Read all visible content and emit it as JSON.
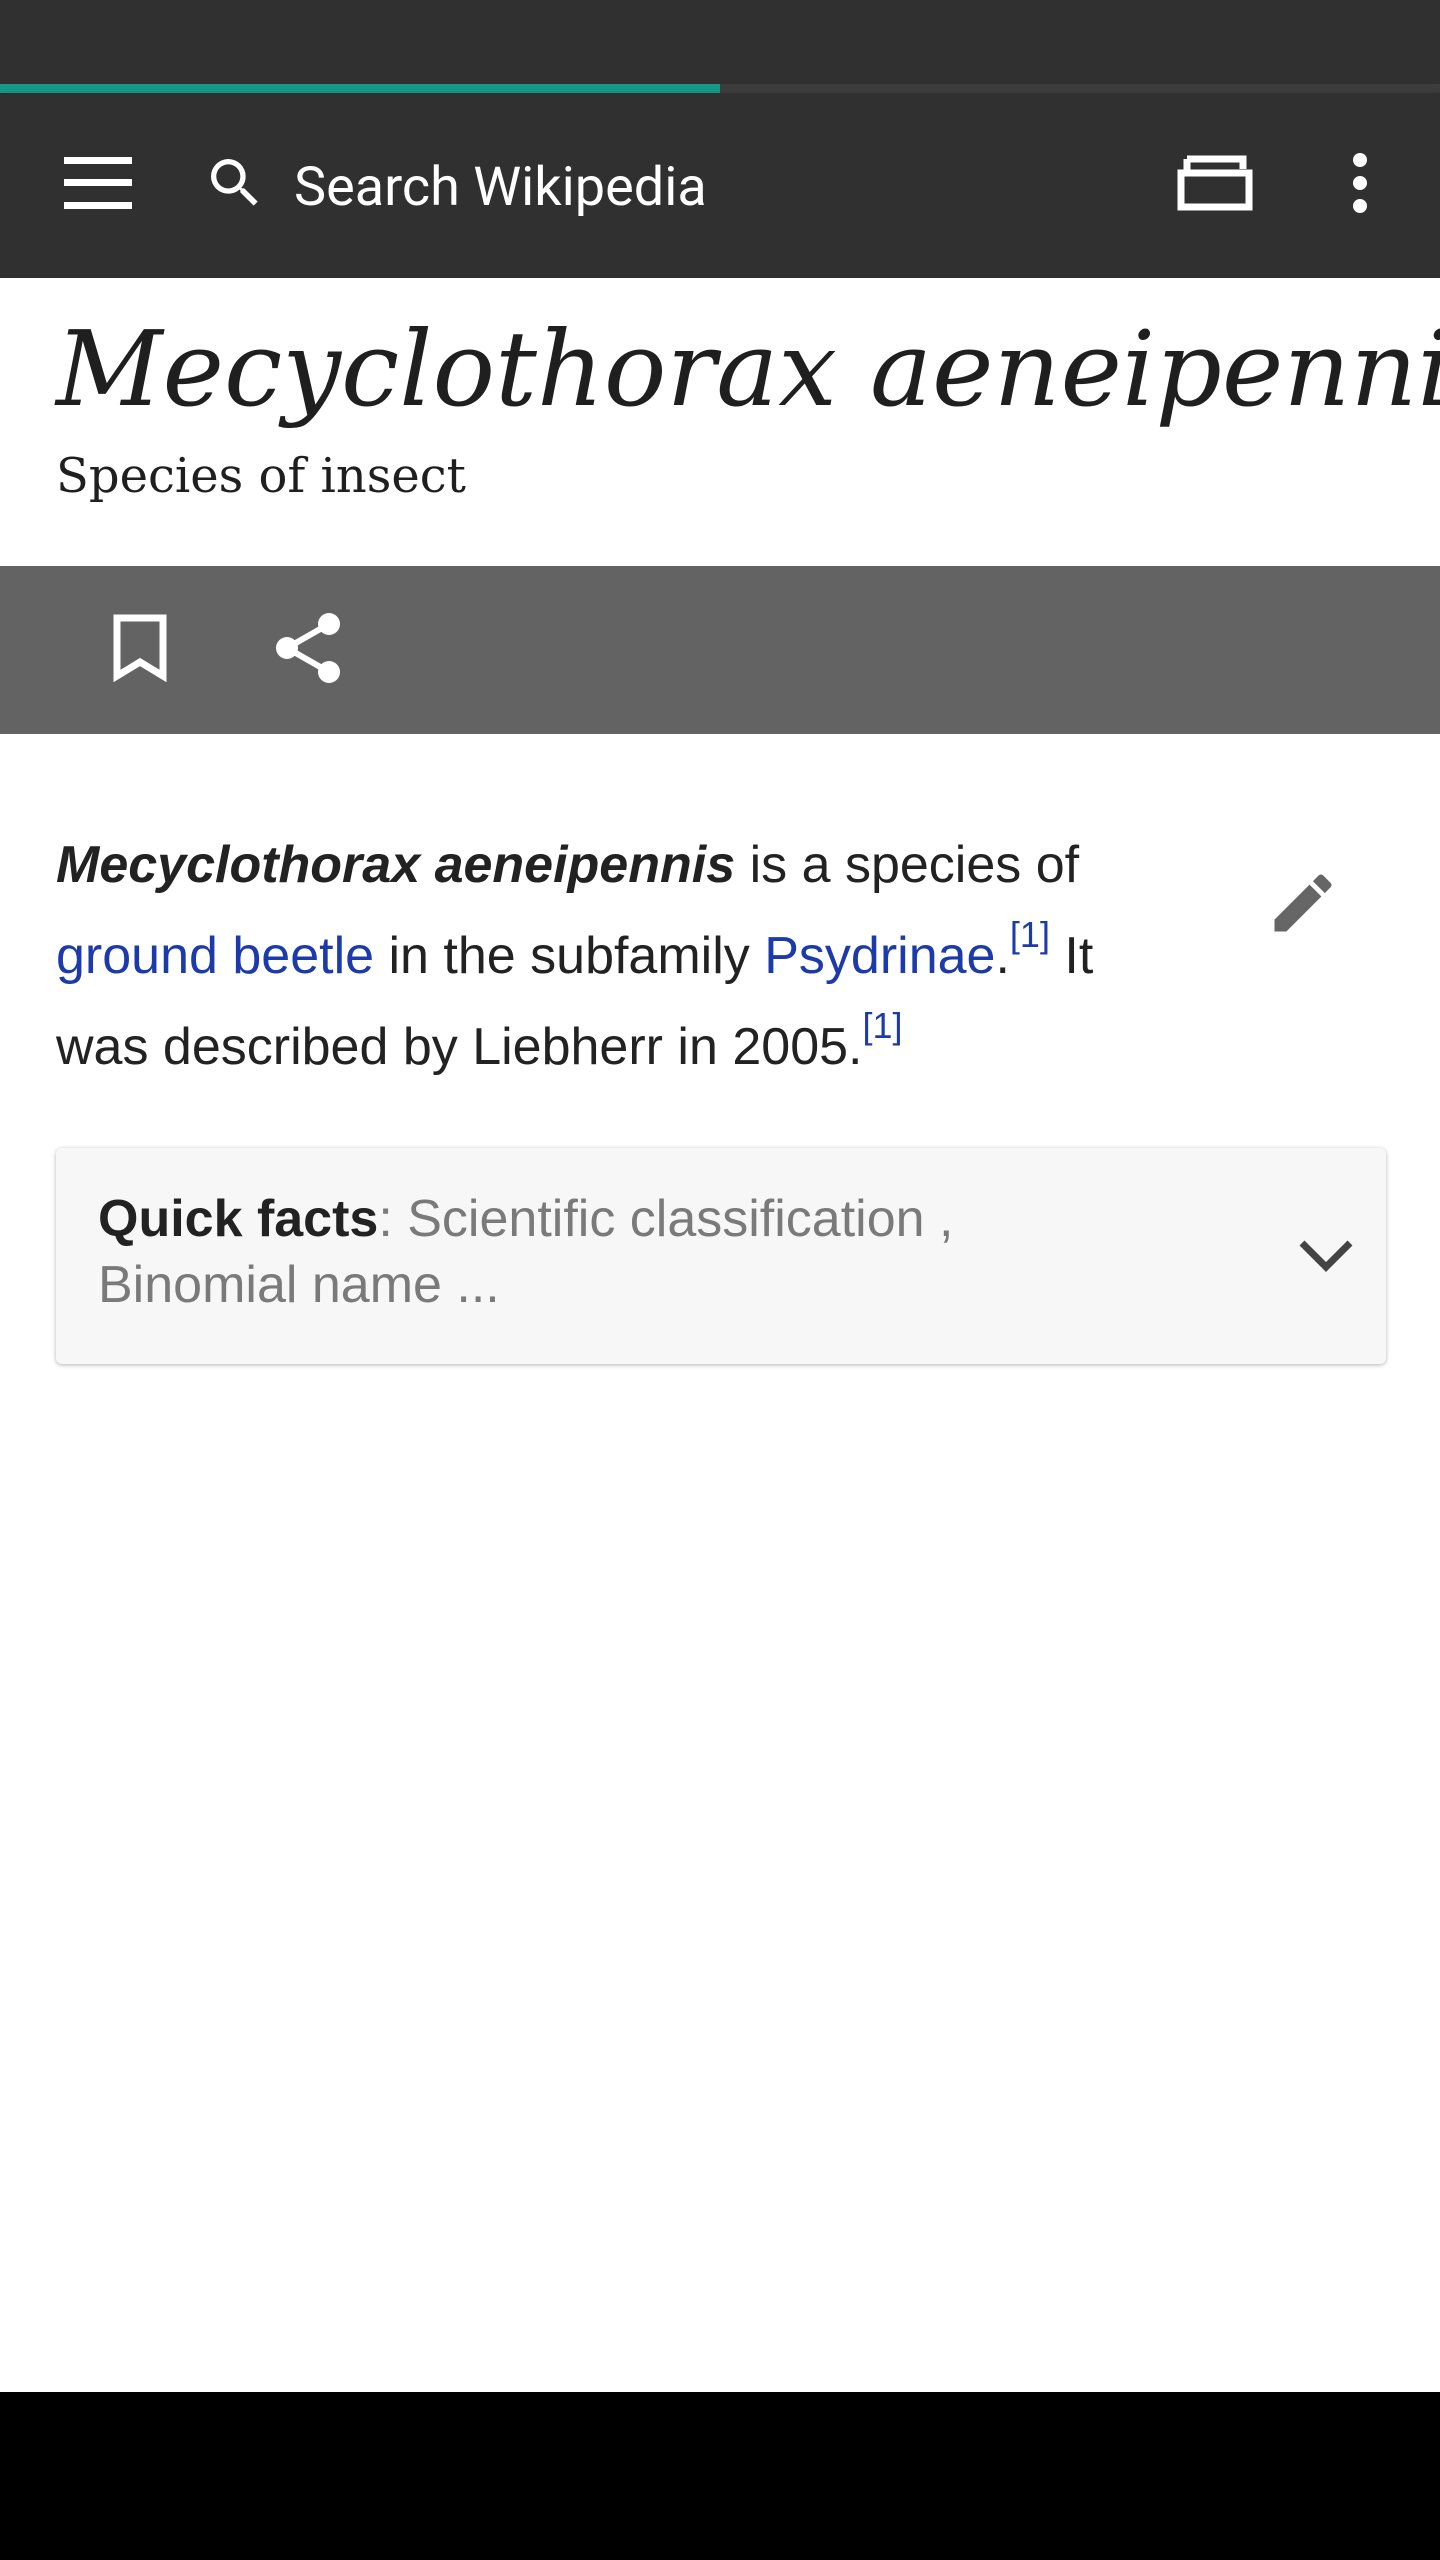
{
  "toolbar": {
    "search_placeholder": "Search Wikipedia",
    "page_load_progress": 0.5
  },
  "article": {
    "title": "Mecyclothorax aeneipennis",
    "subtitle": "Species of insect",
    "lead": {
      "bold_name": "Mecyclothorax aeneipennis",
      "text1": " is a species of ",
      "link1": "ground beetle",
      "text2": " in the subfamily ",
      "link2": "Psydrinae",
      "text3": ".",
      "ref1": "[1]",
      "text4": " It was described by Liebherr in 2005.",
      "ref2": "[1]"
    },
    "quick_facts": {
      "label": "Quick facts",
      "summary": ": Scientific classification , Binomial name ..."
    }
  },
  "colors": {
    "toolbar": "#303030",
    "progress": "#14998a",
    "action_bar": "#636363",
    "link": "#1c3aa9"
  }
}
